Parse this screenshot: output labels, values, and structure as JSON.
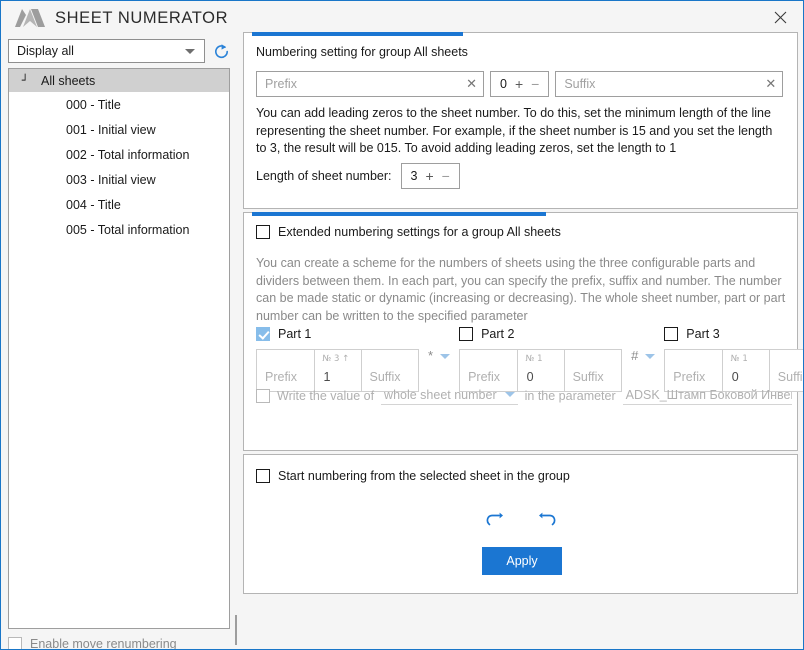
{
  "window": {
    "title": "SHEET NUMERATOR",
    "logo_icon": "three-diamonds-logo",
    "close_icon": "close-icon"
  },
  "sidebar": {
    "filter": {
      "value": "Display all",
      "caret_icon": "chevron-down-icon"
    },
    "refresh_icon": "refresh-icon",
    "tree": {
      "expander_icon": "collapse-arrow-icon",
      "root_label": "All sheets",
      "items": [
        {
          "label": "000 - Title"
        },
        {
          "label": "001 - Initial view"
        },
        {
          "label": "002 - Total information"
        },
        {
          "label": "003 - Initial view"
        },
        {
          "label": "004 - Title"
        },
        {
          "label": "005 - Total information"
        }
      ]
    },
    "status": {
      "checkbox_label": "Enable move renumbering",
      "checked": false,
      "enabled": false
    }
  },
  "numbering_panel": {
    "title": "Numbering setting for group All sheets",
    "prefix": {
      "placeholder": "Prefix",
      "value": "",
      "clear_icon": "clear-x-icon"
    },
    "counter": {
      "value": "0",
      "plus": "+",
      "minus": "−"
    },
    "suffix": {
      "placeholder": "Suffix",
      "value": "",
      "clear_icon": "clear-x-icon"
    },
    "help": "You can add leading zeros to the sheet number. To do this, set the minimum length of the line representing the sheet number. For example, if the sheet number is 15 and you set the length to 3, the result will be 015. To avoid adding leading zeros, set the length to 1",
    "length_label": "Length of sheet number:",
    "length": {
      "value": "3",
      "plus": "+",
      "minus": "−"
    }
  },
  "extended_panel": {
    "checkbox_label": "Extended numbering settings for a group All sheets",
    "checked": false,
    "help": "You can create a scheme for the numbers of sheets using the three configurable parts and dividers between them. In each part, you can specify the prefix, suffix and number. The number can be made static or dynamic (increasing or decreasing). The whole sheet number, part or part number can be written to the specified parameter",
    "parts": [
      {
        "label": "Part 1",
        "checked": true,
        "prefix_placeholder": "Prefix",
        "number_caption": "№ 3 ↑",
        "number_value": "1",
        "suffix_placeholder": "Suffix"
      },
      {
        "label": "Part 2",
        "checked": false,
        "prefix_placeholder": "Prefix",
        "number_caption": "№ 1",
        "number_value": "0",
        "suffix_placeholder": "Suffix"
      },
      {
        "label": "Part 3",
        "checked": false,
        "prefix_placeholder": "Prefix",
        "number_caption": "№ 1",
        "number_value": "0",
        "suffix_placeholder": "Suffix"
      }
    ],
    "dividers": [
      {
        "glyph": "*",
        "caret_icon": "chevron-down-icon"
      },
      {
        "glyph": "#",
        "caret_icon": "chevron-down-icon"
      }
    ],
    "write_row": {
      "checked": false,
      "label_before": "Write the value of",
      "scope_value": "whole sheet number",
      "scope_caret_icon": "chevron-down-icon",
      "label_middle": "in the parameter",
      "parameter_value": "ADSK_Штамп Боковой Инвентарн"
    }
  },
  "start_panel": {
    "checkbox_label": "Start numbering from the selected sheet in the group",
    "checked": false,
    "undo_icon": "undo-icon",
    "redo_icon": "redo-icon",
    "apply_label": "Apply"
  },
  "colors": {
    "accent": "#1b76d2",
    "window_border": "#1976c8",
    "panel_bg": "#f5f5f5",
    "checkbox_checked": "#87bdea"
  }
}
